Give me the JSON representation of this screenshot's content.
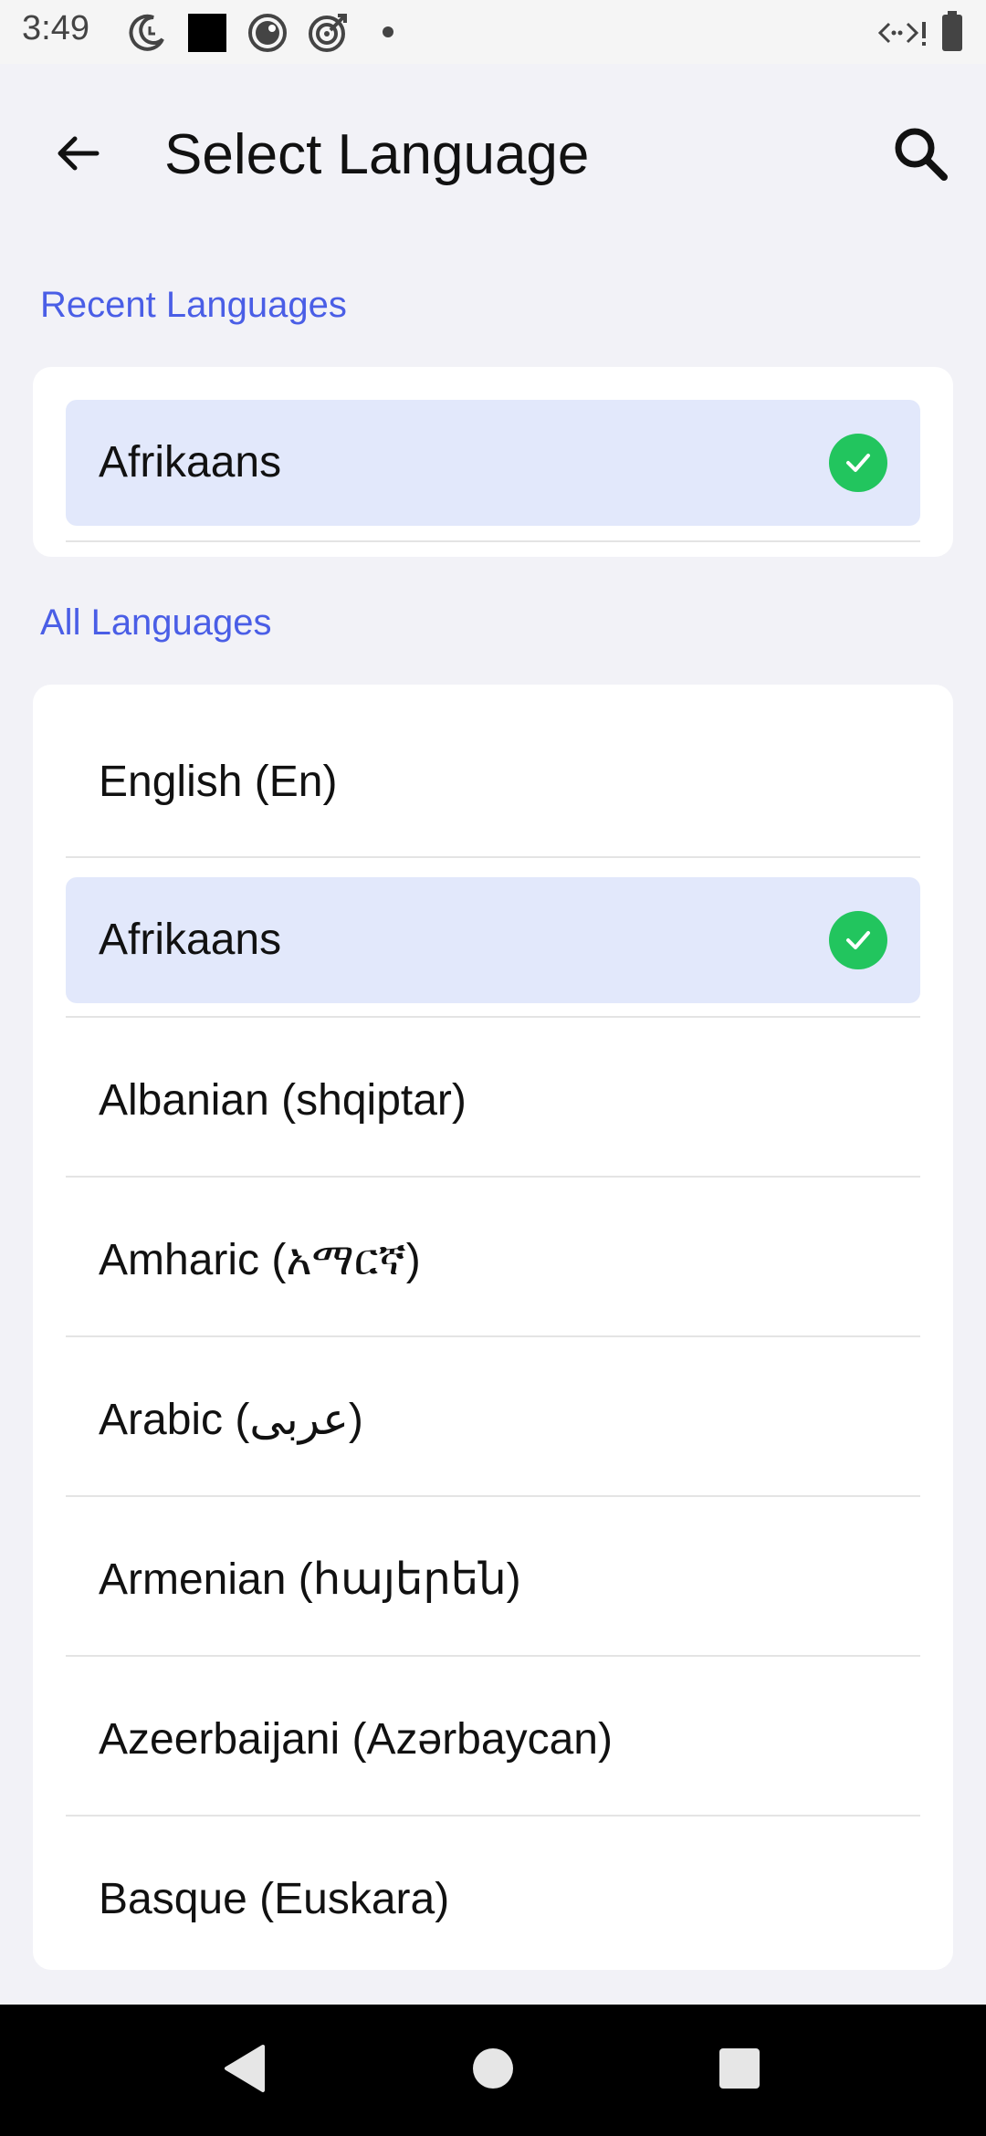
{
  "status_bar": {
    "time": "3:49",
    "icons": [
      "moon-clock-icon",
      "black-square-icon",
      "circle-dot-icon",
      "target-icon",
      "dot-icon",
      "data-arrows-icon",
      "battery-icon"
    ]
  },
  "header": {
    "title": "Select Language",
    "back_icon": "arrow-left-icon",
    "search_icon": "search-icon"
  },
  "recent": {
    "heading": "Recent Languages",
    "items": [
      {
        "label": "Afrikaans",
        "selected": true
      }
    ]
  },
  "all": {
    "heading": "All Languages",
    "items": [
      {
        "label": "English (En)",
        "selected": false
      },
      {
        "label": "Afrikaans",
        "selected": true
      },
      {
        "label": "Albanian (shqiptar)",
        "selected": false
      },
      {
        "label": "Amharic (አማርኛ)",
        "selected": false
      },
      {
        "label": "Arabic (عربى)",
        "selected": false
      },
      {
        "label": "Armenian (հայերեն)",
        "selected": false
      },
      {
        "label": "Azeerbaijani (Azərbaycan)",
        "selected": false
      },
      {
        "label": "Basque (Euskara)",
        "selected": false
      }
    ]
  },
  "colors": {
    "accent": "#4a5ee6",
    "selected_bg": "#e2e8fb",
    "check_green": "#22c55e",
    "page_bg": "#f2f2f7"
  },
  "nav_bar": {
    "icons": [
      "back-triangle-icon",
      "home-circle-icon",
      "recents-square-icon"
    ]
  }
}
